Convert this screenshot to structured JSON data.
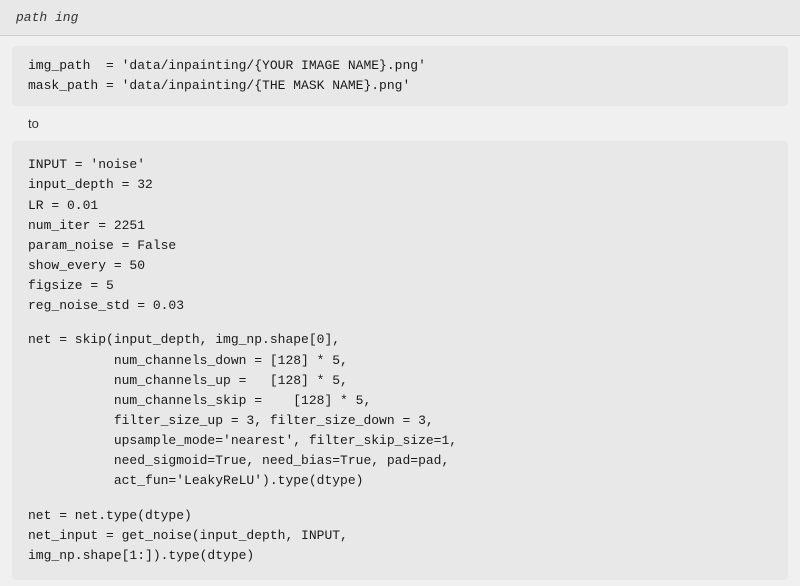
{
  "page": {
    "title": "path ing"
  },
  "top_bar": {
    "text": "path ing"
  },
  "code_block_1": {
    "lines": [
      "img_path  = 'data/inpainting/{YOUR IMAGE NAME}.png'",
      "mask_path = 'data/inpainting/{THE MASK NAME}.png'"
    ]
  },
  "to_label": "to",
  "code_block_2": {
    "lines": [
      "INPUT = 'noise'",
      "input_depth = 32",
      "LR = 0.01",
      "num_iter = 2251",
      "param_noise = False",
      "show_every = 50",
      "figsize = 5",
      "reg_noise_std = 0.03",
      "",
      "net = skip(input_depth, img_np.shape[0],",
      "           num_channels_down = [128] * 5,",
      "           num_channels_up =   [128] * 5,",
      "           num_channels_skip =    [128] * 5,",
      "           filter_size_up = 3, filter_size_down = 3,",
      "           upsample_mode='nearest', filter_skip_size=1,",
      "           need_sigmoid=True, need_bias=True, pad=pad,",
      "           act_fun='LeakyReLU').type(dtype)",
      "",
      "net = net.type(dtype)",
      "net_input = get_noise(input_depth, INPUT,",
      "img_np.shape[1:]).type(dtype)"
    ]
  }
}
